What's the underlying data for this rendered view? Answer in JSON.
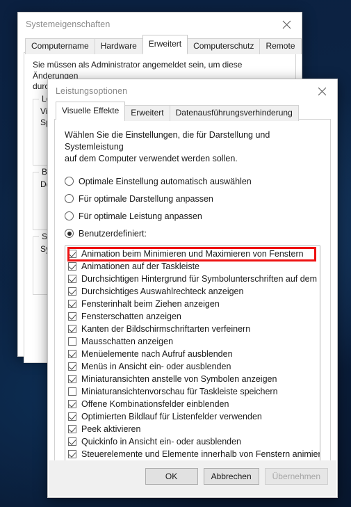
{
  "desktop": {
    "background_color": "#0b2040"
  },
  "system_properties": {
    "title": "Systemeigenschaften",
    "close_label": "✕",
    "tabs": [
      {
        "label": "Computername",
        "active": false
      },
      {
        "label": "Hardware",
        "active": false
      },
      {
        "label": "Erweitert",
        "active": true
      },
      {
        "label": "Computerschutz",
        "active": false
      },
      {
        "label": "Remote",
        "active": false
      }
    ],
    "intro_line1": "Sie müssen als Administrator angemeldet sein, um diese Änderungen",
    "intro_line2": "durchführen zu können.",
    "groups": [
      {
        "title": "Leis",
        "lines": [
          "Visu",
          "Spe"
        ]
      },
      {
        "title": "Ben",
        "lines": [
          "Des"
        ]
      },
      {
        "title": "Sta",
        "lines": [
          "Sys"
        ]
      }
    ]
  },
  "performance_options": {
    "title": "Leistungsoptionen",
    "close_label": "✕",
    "tabs": [
      {
        "label": "Visuelle Effekte",
        "active": true
      },
      {
        "label": "Erweitert",
        "active": false
      },
      {
        "label": "Datenausführungsverhinderung",
        "active": false
      }
    ],
    "intro_line1": "Wählen Sie die Einstellungen, die für Darstellung und Systemleistung",
    "intro_line2": "auf dem Computer verwendet werden sollen.",
    "radio_options": [
      {
        "label": "Optimale Einstellung automatisch auswählen",
        "checked": false
      },
      {
        "label": "Für optimale Darstellung anpassen",
        "checked": false
      },
      {
        "label": "Für optimale Leistung anpassen",
        "checked": false
      },
      {
        "label": "Benutzerdefiniert:",
        "checked": true
      }
    ],
    "effects": [
      {
        "label": "Animation beim Minimieren und Maximieren von Fenstern",
        "checked": true,
        "highlighted": true
      },
      {
        "label": "Animationen auf der Taskleiste",
        "checked": true,
        "highlighted": false
      },
      {
        "label": "Durchsichtigen Hintergrund für Symbolunterschriften auf dem De",
        "checked": true,
        "highlighted": false
      },
      {
        "label": "Durchsichtiges Auswahlrechteck anzeigen",
        "checked": true,
        "highlighted": false
      },
      {
        "label": "Fensterinhalt beim Ziehen anzeigen",
        "checked": true,
        "highlighted": false
      },
      {
        "label": "Fensterschatten anzeigen",
        "checked": true,
        "highlighted": false
      },
      {
        "label": "Kanten der Bildschirmschriftarten verfeinern",
        "checked": true,
        "highlighted": false
      },
      {
        "label": "Mausschatten anzeigen",
        "checked": false,
        "highlighted": false
      },
      {
        "label": "Menüelemente nach Aufruf ausblenden",
        "checked": true,
        "highlighted": false
      },
      {
        "label": "Menüs in Ansicht ein- oder ausblenden",
        "checked": true,
        "highlighted": false
      },
      {
        "label": "Miniaturansichten anstelle von Symbolen anzeigen",
        "checked": true,
        "highlighted": false
      },
      {
        "label": "Miniaturansichtenvorschau für Taskleiste speichern",
        "checked": false,
        "highlighted": false
      },
      {
        "label": "Offene Kombinationsfelder einblenden",
        "checked": true,
        "highlighted": false
      },
      {
        "label": "Optimierten Bildlauf für Listenfelder verwenden",
        "checked": true,
        "highlighted": false
      },
      {
        "label": "Peek aktivieren",
        "checked": true,
        "highlighted": false
      },
      {
        "label": "Quickinfo in Ansicht ein- oder ausblenden",
        "checked": true,
        "highlighted": false
      },
      {
        "label": "Steuerelemente und Elemente innerhalb von Fenstern animieren",
        "checked": true,
        "highlighted": false
      }
    ],
    "scrollbar": {
      "left_arrow": "‹",
      "right_arrow": "›",
      "thumb_percent": 82
    },
    "buttons": [
      {
        "label": "OK",
        "disabled": false
      },
      {
        "label": "Abbrechen",
        "disabled": false
      },
      {
        "label": "Übernehmen",
        "disabled": true
      }
    ],
    "highlight_color": "#ee1111"
  }
}
